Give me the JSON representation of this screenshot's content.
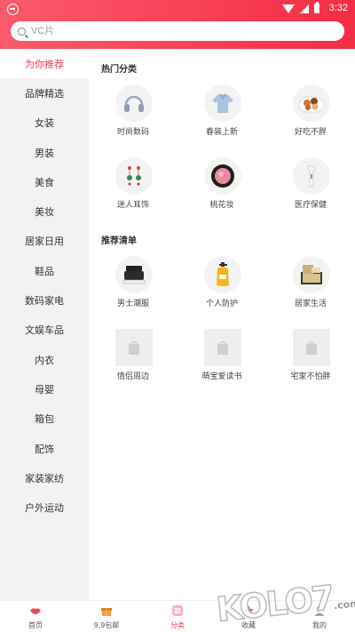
{
  "status_bar": {
    "time": "3:32"
  },
  "search": {
    "placeholder": "VC片"
  },
  "sidebar": {
    "items": [
      {
        "label": "为你推荐",
        "active": true
      },
      {
        "label": "品牌精选"
      },
      {
        "label": "女装"
      },
      {
        "label": "男装"
      },
      {
        "label": "美食"
      },
      {
        "label": "美妆"
      },
      {
        "label": "居家日用"
      },
      {
        "label": "鞋品"
      },
      {
        "label": "数码家电"
      },
      {
        "label": "文娱车品"
      },
      {
        "label": "内衣"
      },
      {
        "label": "母婴"
      },
      {
        "label": "箱包"
      },
      {
        "label": "配饰"
      },
      {
        "label": "家装家纺"
      },
      {
        "label": "户外运动"
      }
    ]
  },
  "hot_section": {
    "title": "热门分类",
    "items": [
      {
        "label": "时尚数码",
        "icon": "headphones-icon"
      },
      {
        "label": "春装上新",
        "icon": "blouse-icon"
      },
      {
        "label": "好吃不胖",
        "icon": "snack-plate-icon"
      },
      {
        "label": "迷人耳饰",
        "icon": "earrings-icon"
      },
      {
        "label": "桃花妆",
        "icon": "blush-compact-icon"
      },
      {
        "label": "医疗保健",
        "icon": "thermometer-icon"
      }
    ]
  },
  "recommend_section": {
    "title": "推荐清单",
    "items": [
      {
        "label": "男士潮服",
        "icon": "sneaker-icon"
      },
      {
        "label": "个人防护",
        "icon": "hand-sanitizer-icon"
      },
      {
        "label": "居家生活",
        "icon": "storage-box-icon"
      },
      {
        "label": "情侣周边",
        "icon": "placeholder-bag-icon"
      },
      {
        "label": "萌宝爱读书",
        "icon": "placeholder-bag-icon"
      },
      {
        "label": "宅家不怕胖",
        "icon": "placeholder-bag-icon"
      }
    ]
  },
  "tabbar": {
    "tabs": [
      {
        "label": "首页",
        "icon": "lips-icon"
      },
      {
        "label": "9.9包邮",
        "icon": "gift-icon"
      },
      {
        "label": "分类",
        "icon": "category-icon",
        "active": true
      },
      {
        "label": "收藏",
        "icon": "star-icon"
      },
      {
        "label": "我的",
        "icon": "user-icon"
      }
    ]
  },
  "watermark": {
    "text": "KOLO7",
    "suffix": ".com"
  },
  "colors": {
    "accent": "#f23a4f",
    "header_start": "#fb5a6c",
    "header_end": "#f52c45"
  }
}
